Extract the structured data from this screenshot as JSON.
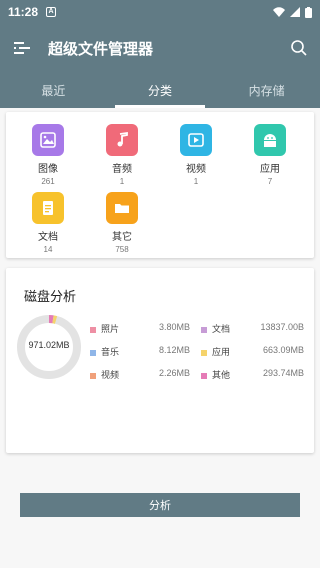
{
  "status": {
    "time": "11:28",
    "notif": "A"
  },
  "app": {
    "title": "超级文件管理器"
  },
  "tabs": [
    {
      "label": "最近"
    },
    {
      "label": "分类"
    },
    {
      "label": "内存储"
    }
  ],
  "categories": [
    {
      "label": "图像",
      "count": "261",
      "color": "#a779e8",
      "icon": "image-icon"
    },
    {
      "label": "音频",
      "count": "1",
      "color": "#f06a79",
      "icon": "music-note-icon"
    },
    {
      "label": "视频",
      "count": "1",
      "color": "#2fb5e4",
      "icon": "video-icon"
    },
    {
      "label": "应用",
      "count": "7",
      "color": "#30c7ad",
      "icon": "android-icon"
    },
    {
      "label": "文档",
      "count": "14",
      "color": "#f7c22c",
      "icon": "document-icon"
    },
    {
      "label": "其它",
      "count": "758",
      "color": "#f7a21b",
      "icon": "folder-icon"
    }
  ],
  "disk": {
    "title": "磁盘分析",
    "total": "971.02MB",
    "legend": [
      {
        "label": "照片",
        "value": "3.80MB",
        "color": "#ee8fa4"
      },
      {
        "label": "音乐",
        "value": "8.12MB",
        "color": "#8fb6e8"
      },
      {
        "label": "视频",
        "value": "2.26MB",
        "color": "#f0a07a"
      },
      {
        "label": "文档",
        "value": "13837.00B",
        "color": "#c79cd6"
      },
      {
        "label": "应用",
        "value": "663.09MB",
        "color": "#f5d36b"
      },
      {
        "label": "其他",
        "value": "293.74MB",
        "color": "#e57bb6"
      }
    ],
    "button_label": "分析"
  }
}
